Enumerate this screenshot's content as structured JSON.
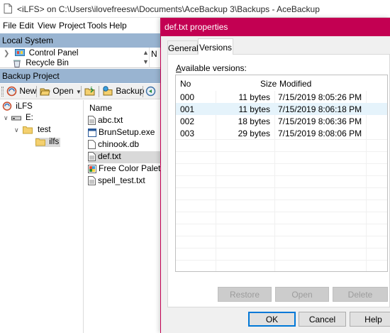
{
  "window": {
    "title": "<iLFS> on C:\\Users\\ilovefreesw\\Documents\\AceBackup 3\\Backups - AceBackup"
  },
  "menu": [
    "File",
    "Edit",
    "View",
    "Project",
    "Tools",
    "Help"
  ],
  "local_system": {
    "header": "Local System",
    "items": [
      "Control Panel",
      "Recycle Bin"
    ],
    "column_initial": "N"
  },
  "backup_project": {
    "header": "Backup Project",
    "toolbar": {
      "new": "New",
      "open": "Open",
      "backup": "Backup"
    },
    "tree": {
      "root": "iLFS",
      "drive": "E:",
      "folder": "test",
      "subfolder": "ilfs"
    },
    "files_header": "Name",
    "files": [
      "abc.txt",
      "BrunSetup.exe",
      "chinook.db",
      "def.txt",
      "Free Color Palet...",
      "spell_test.txt"
    ],
    "selected_file_index": 3
  },
  "dialog": {
    "title": "def.txt properties",
    "tabs": [
      "General",
      "Versions"
    ],
    "active_tab": "Versions",
    "versions_label": "Available versions:",
    "columns": [
      "No",
      "Size",
      "Modified"
    ],
    "versions": [
      {
        "no": "000",
        "size": "11 bytes",
        "modified": "7/15/2019 8:05:26 PM"
      },
      {
        "no": "001",
        "size": "11 bytes",
        "modified": "7/15/2019 8:06:18 PM"
      },
      {
        "no": "002",
        "size": "18 bytes",
        "modified": "7/15/2019 8:06:36 PM"
      },
      {
        "no": "003",
        "size": "29 bytes",
        "modified": "7/15/2019 8:08:06 PM"
      }
    ],
    "selected_version_index": 1,
    "action_buttons": {
      "restore": "Restore",
      "open": "Open",
      "delete": "Delete"
    },
    "footer_buttons": {
      "ok": "OK",
      "cancel": "Cancel",
      "help": "Help"
    },
    "accent_color": "#c30052"
  }
}
